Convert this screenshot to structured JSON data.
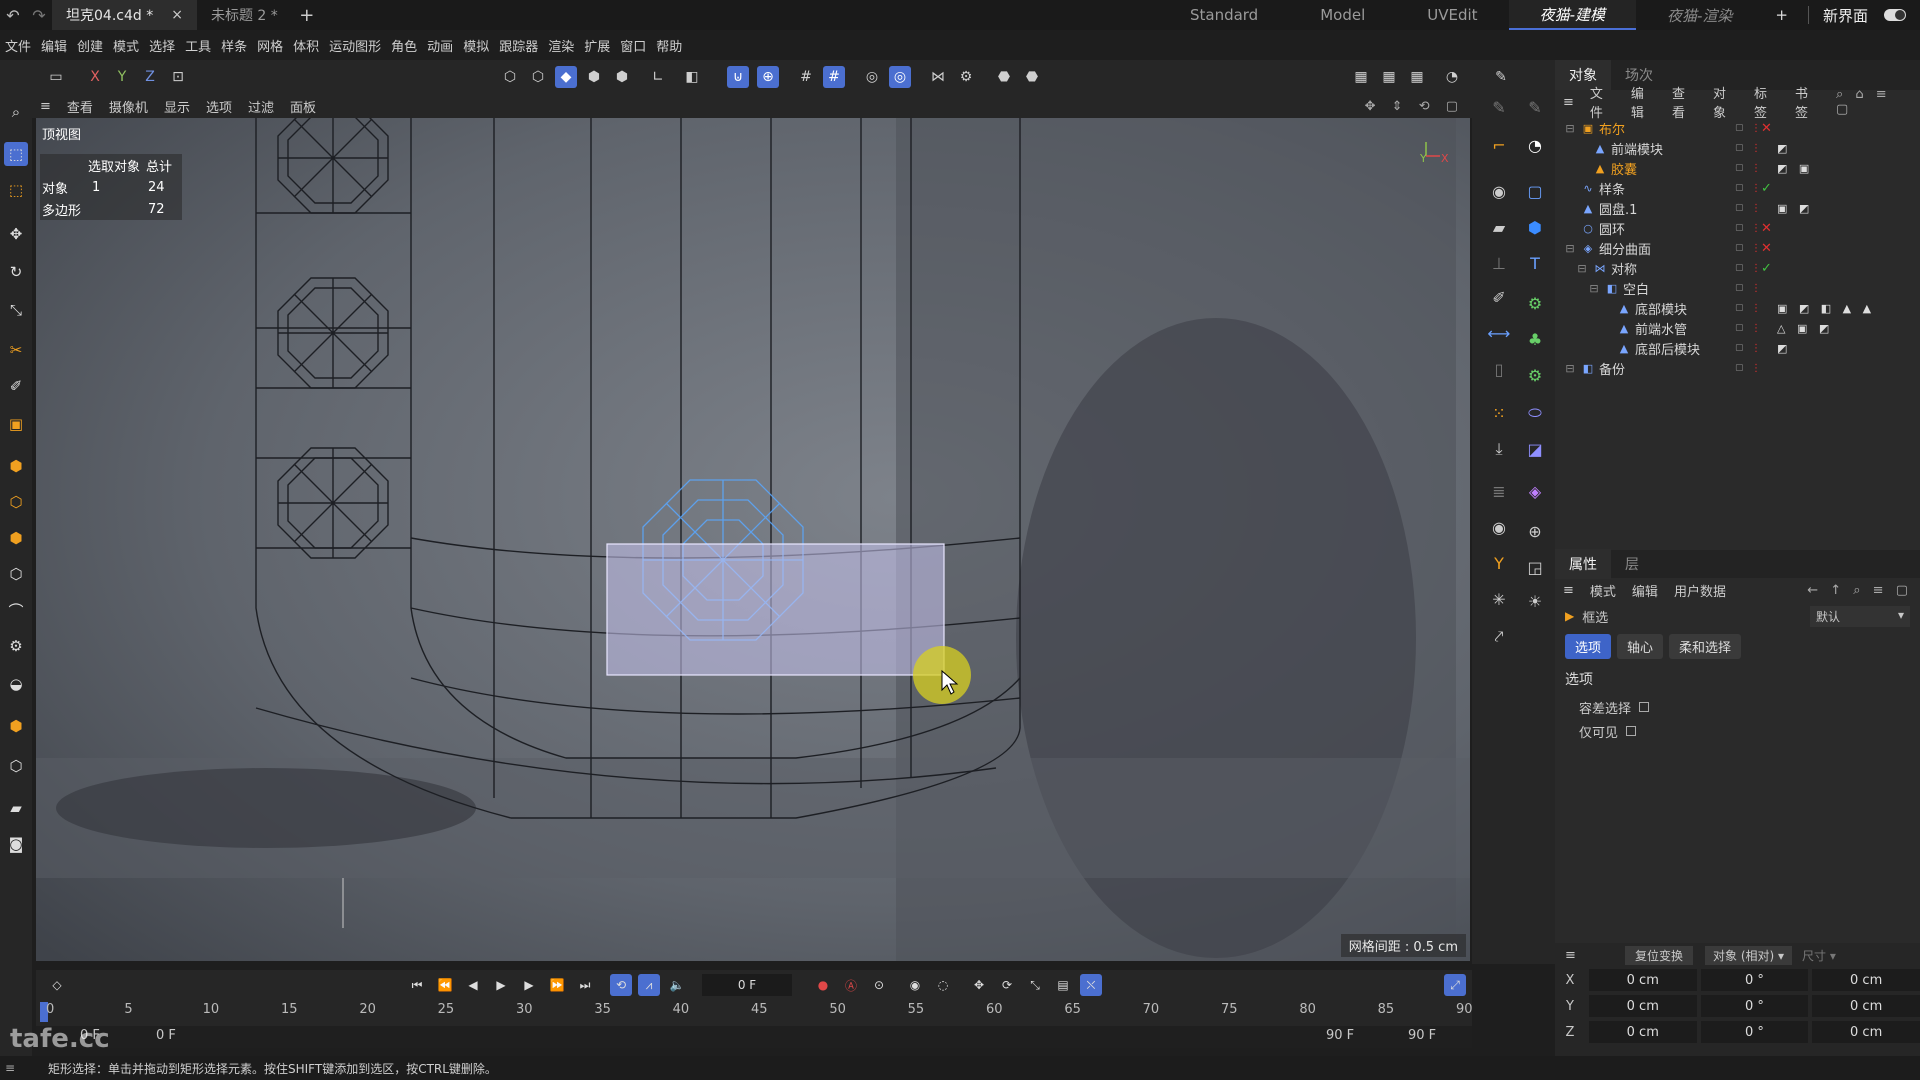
{
  "title_bar": {
    "tabs": [
      {
        "label": "坦克04.c4d *",
        "active": true,
        "close": "×"
      },
      {
        "label": "未标题 2 *",
        "active": false
      }
    ],
    "add_tab": "+",
    "layouts": [
      "Standard",
      "Model",
      "UVEdit",
      "夜猫-建模",
      "夜猫-渲染"
    ],
    "active_layout": "夜猫-建模",
    "add_layout": "+",
    "new_interface": "新界面"
  },
  "menu_bar": [
    "文件",
    "编辑",
    "创建",
    "模式",
    "选择",
    "工具",
    "样条",
    "网格",
    "体积",
    "运动图形",
    "角色",
    "动画",
    "模拟",
    "跟踪器",
    "渲染",
    "扩展",
    "窗口",
    "帮助"
  ],
  "toolbar": {
    "axis_x": "X",
    "axis_y": "Y",
    "axis_z": "Z"
  },
  "viewport": {
    "menu": [
      "查看",
      "摄像机",
      "显示",
      "选项",
      "过滤",
      "面板"
    ],
    "view_name": "顶视图",
    "stats": {
      "header_selected": "选取对象",
      "header_total": "总计",
      "rows": [
        {
          "label": "对象",
          "selected": "1",
          "total": "24"
        },
        {
          "label": "多边形",
          "selected": "",
          "total": "72"
        }
      ]
    },
    "grid_spacing": "网格间距 : 0.5 cm",
    "axis_y": "Y",
    "axis_x": "X"
  },
  "object_manager": {
    "tabs": [
      "对象",
      "场次"
    ],
    "menu": [
      "文件",
      "编辑",
      "查看",
      "对象",
      "标签",
      "书签"
    ],
    "tree": [
      {
        "name": "布尔",
        "indent": 0,
        "icon": "boolean-icon",
        "highlight": true,
        "status": "x",
        "tags": ""
      },
      {
        "name": "前端模块",
        "indent": 1,
        "icon": "polygon-object-icon",
        "highlight": false,
        "status": "",
        "tags": "◩"
      },
      {
        "name": "胶囊",
        "indent": 1,
        "icon": "polygon-object-icon",
        "highlight": true,
        "status": "",
        "tags": "◩ ▣"
      },
      {
        "name": "样条",
        "indent": 0,
        "icon": "spline-icon",
        "highlight": false,
        "status": "check",
        "tags": ""
      },
      {
        "name": "圆盘.1",
        "indent": 0,
        "icon": "polygon-object-icon",
        "highlight": false,
        "status": "",
        "tags": "▣ ◩"
      },
      {
        "name": "圆环",
        "indent": 0,
        "icon": "ring-icon",
        "highlight": false,
        "status": "x",
        "tags": ""
      },
      {
        "name": "细分曲面",
        "indent": 0,
        "icon": "subdivision-icon",
        "highlight": false,
        "status": "x",
        "tags": ""
      },
      {
        "name": "对称",
        "indent": 1,
        "icon": "symmetry-icon",
        "highlight": false,
        "status": "check",
        "tags": ""
      },
      {
        "name": "空白",
        "indent": 2,
        "icon": "null-icon",
        "highlight": false,
        "status": "",
        "tags": ""
      },
      {
        "name": "底部模块",
        "indent": 3,
        "icon": "polygon-object-icon",
        "highlight": false,
        "status": "",
        "tags": "▣ ◩ ◧ ▲ ▲"
      },
      {
        "name": "前端水管",
        "indent": 3,
        "icon": "polygon-object-icon",
        "highlight": false,
        "status": "",
        "tags": "△ ▣ ◩"
      },
      {
        "name": "底部后模块",
        "indent": 3,
        "icon": "polygon-object-icon",
        "highlight": false,
        "status": "",
        "tags": "◩"
      },
      {
        "name": "备份",
        "indent": 0,
        "icon": "null-icon",
        "highlight": false,
        "status": "",
        "tags": ""
      }
    ]
  },
  "attributes": {
    "tabs": [
      "属性",
      "层"
    ],
    "menu": [
      "模式",
      "编辑",
      "用户数据"
    ],
    "tool_name": "框选",
    "preset": "默认",
    "sub_tabs": [
      "选项",
      "轴心",
      "柔和选择"
    ],
    "section": "选项",
    "checkboxes": [
      {
        "label": "容差选择",
        "checked": false
      },
      {
        "label": "仅可见",
        "checked": false
      }
    ]
  },
  "coordinates": {
    "reset_button": "复位变换",
    "mode": "对象 (相对)",
    "size_label": "尺寸",
    "rows": [
      {
        "axis": "X",
        "pos": "0 cm",
        "rot": "0 °",
        "size": "0 cm"
      },
      {
        "axis": "Y",
        "pos": "0 cm",
        "rot": "0 °",
        "size": "0 cm"
      },
      {
        "axis": "Z",
        "pos": "0 cm",
        "rot": "0 °",
        "size": "0 cm"
      }
    ]
  },
  "timeline": {
    "current_frame": "0 F",
    "ticks": [
      "0",
      "5",
      "10",
      "15",
      "20",
      "25",
      "30",
      "35",
      "40",
      "45",
      "50",
      "55",
      "60",
      "65",
      "70",
      "75",
      "80",
      "85",
      "90"
    ],
    "range_start": "0 F",
    "range_start2": "0 F",
    "range_end": "90 F",
    "range_end2": "90 F"
  },
  "status_bar": "矩形选择：单击并拖动到矩形选择元素。按住SHIFT键添加到选区，按CTRL键删除。",
  "watermark": "tafe.cc"
}
